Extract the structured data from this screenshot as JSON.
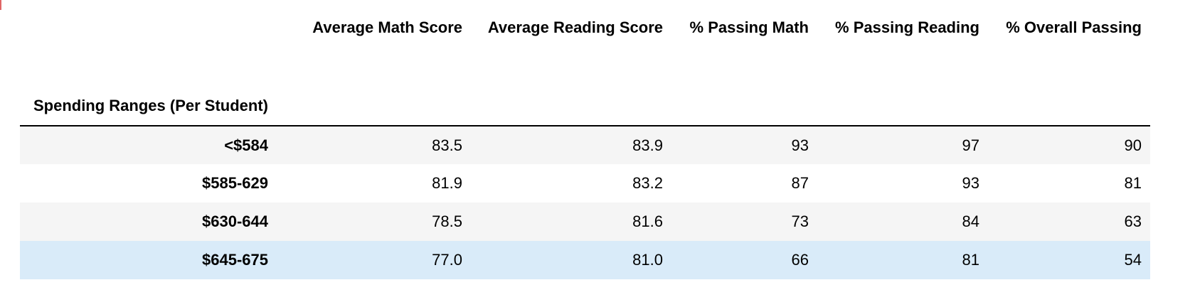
{
  "table": {
    "index_name": "Spending Ranges (Per Student)",
    "columns": [
      "Average Math Score",
      "Average Reading Score",
      "% Passing Math",
      "% Passing Reading",
      "% Overall Passing"
    ],
    "rows": [
      {
        "label": "<$584",
        "values": [
          "83.5",
          "83.9",
          "93",
          "97",
          "90"
        ]
      },
      {
        "label": "$585-629",
        "values": [
          "81.9",
          "83.2",
          "87",
          "93",
          "81"
        ]
      },
      {
        "label": "$630-644",
        "values": [
          "78.5",
          "81.6",
          "73",
          "84",
          "63"
        ]
      },
      {
        "label": "$645-675",
        "values": [
          "77.0",
          "81.0",
          "66",
          "81",
          "54"
        ]
      }
    ],
    "highlighted_row": 3,
    "colors": {
      "striped_row": "#f5f5f5",
      "hover_row": "#d9ebf9"
    }
  }
}
